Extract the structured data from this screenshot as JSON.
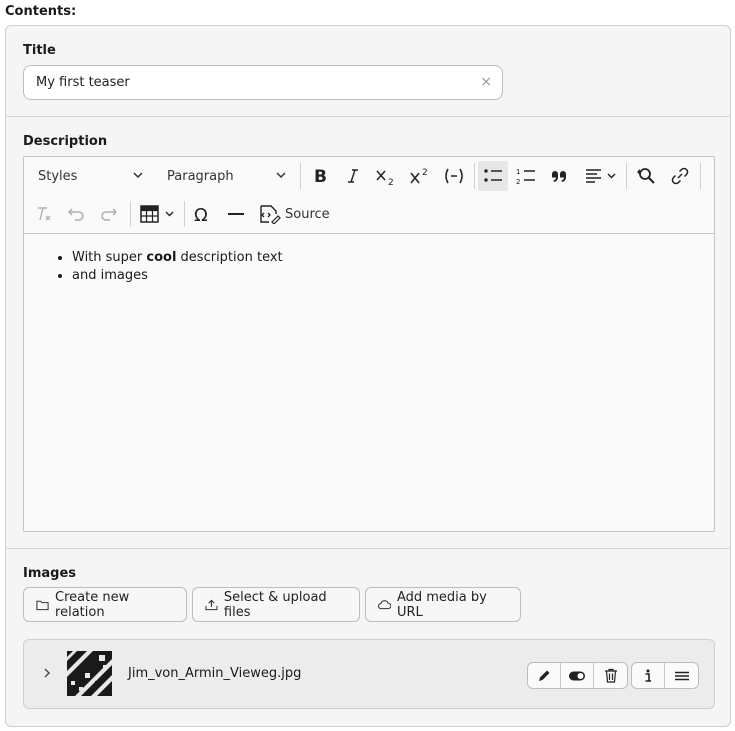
{
  "heading": "Contents:",
  "title_field": {
    "label": "Title",
    "value": "My first teaser",
    "clear_symbol": "×"
  },
  "description_field": {
    "label": "Description",
    "toolbar": {
      "styles_label": "Styles",
      "paragraph_label": "Paragraph",
      "source_label": "Source",
      "buttons": [
        "bold-icon",
        "italic-icon",
        "subscript-icon",
        "superscript-icon",
        "code-icon",
        "bulleted-list-icon",
        "numbered-list-icon",
        "blockquote-icon",
        "align-icon",
        "find-replace-icon",
        "link-icon",
        "remove-format-icon",
        "undo-icon",
        "redo-icon",
        "table-icon",
        "special-characters-icon",
        "horizontal-line-icon",
        "source-icon"
      ]
    },
    "content": {
      "item1_before": "With super ",
      "item1_bold": "cool",
      "item1_after": " description text",
      "item2": "and images"
    }
  },
  "images_field": {
    "label": "Images",
    "buttons": {
      "create_relation": "Create new relation",
      "select_upload": "Select & upload files",
      "add_media": "Add media by URL"
    },
    "file": {
      "name": "Jim_von_Armin_Vieweg.jpg"
    }
  }
}
